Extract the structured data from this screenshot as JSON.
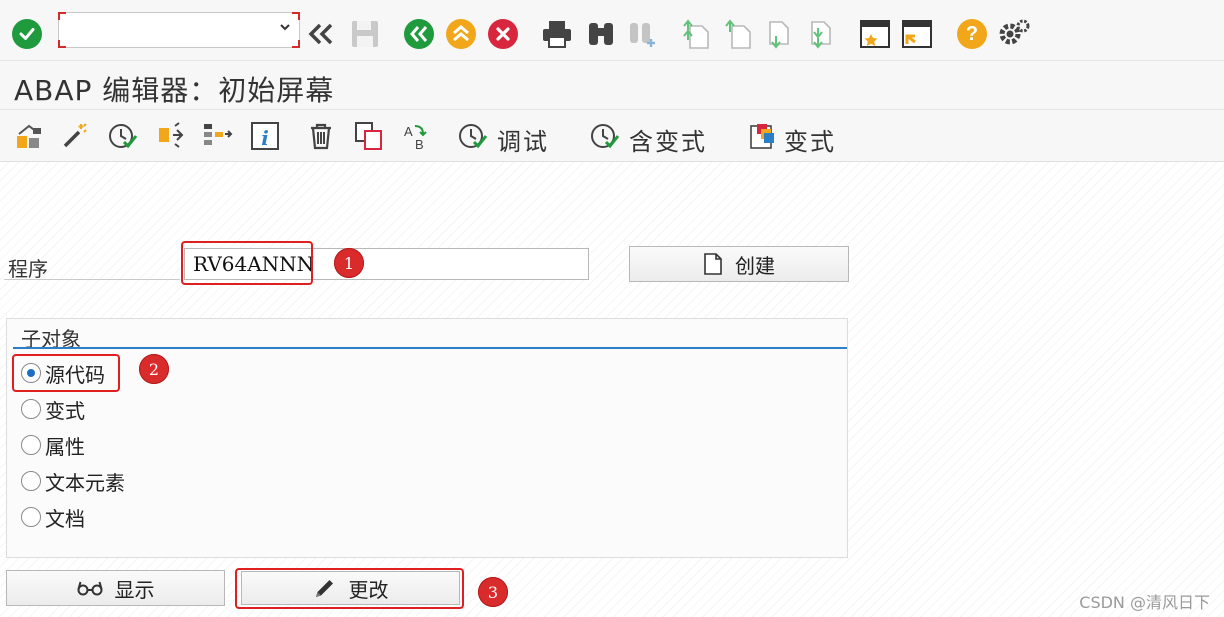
{
  "toolbar": {
    "command_field": {
      "value": "",
      "placeholder": ""
    },
    "icons": [
      "enter-icon",
      "back-double-chevron-icon",
      "save-icon",
      "back-icon",
      "exit-icon",
      "cancel-icon",
      "print-icon",
      "find-icon",
      "find-next-icon",
      "first-page-icon",
      "prev-page-icon",
      "next-page-icon",
      "last-page-icon",
      "create-session-icon",
      "shortcut-icon",
      "help-icon",
      "settings-icon"
    ]
  },
  "title": "ABAP 编辑器：初始屏幕",
  "app_toolbar": {
    "debug_label": "调试",
    "with_variant_label": "含变式",
    "variants_label": "变式"
  },
  "program": {
    "label": "程序",
    "value": "RV64ANNN",
    "create_button": "创建"
  },
  "subobjects": {
    "title": "子对象",
    "options": [
      "源代码",
      "变式",
      "属性",
      "文本元素",
      "文档"
    ],
    "selected": "源代码"
  },
  "buttons": {
    "display": "显示",
    "change": "更改"
  },
  "annotations": [
    "1",
    "2",
    "3"
  ],
  "watermark": "CSDN @清风日下",
  "colors": {
    "accent_green": "#1f9a3c",
    "accent_orange": "#f2a71b",
    "accent_red": "#d7263d",
    "annotation_red": "#e02020",
    "selection_blue": "#1c6fc4"
  }
}
